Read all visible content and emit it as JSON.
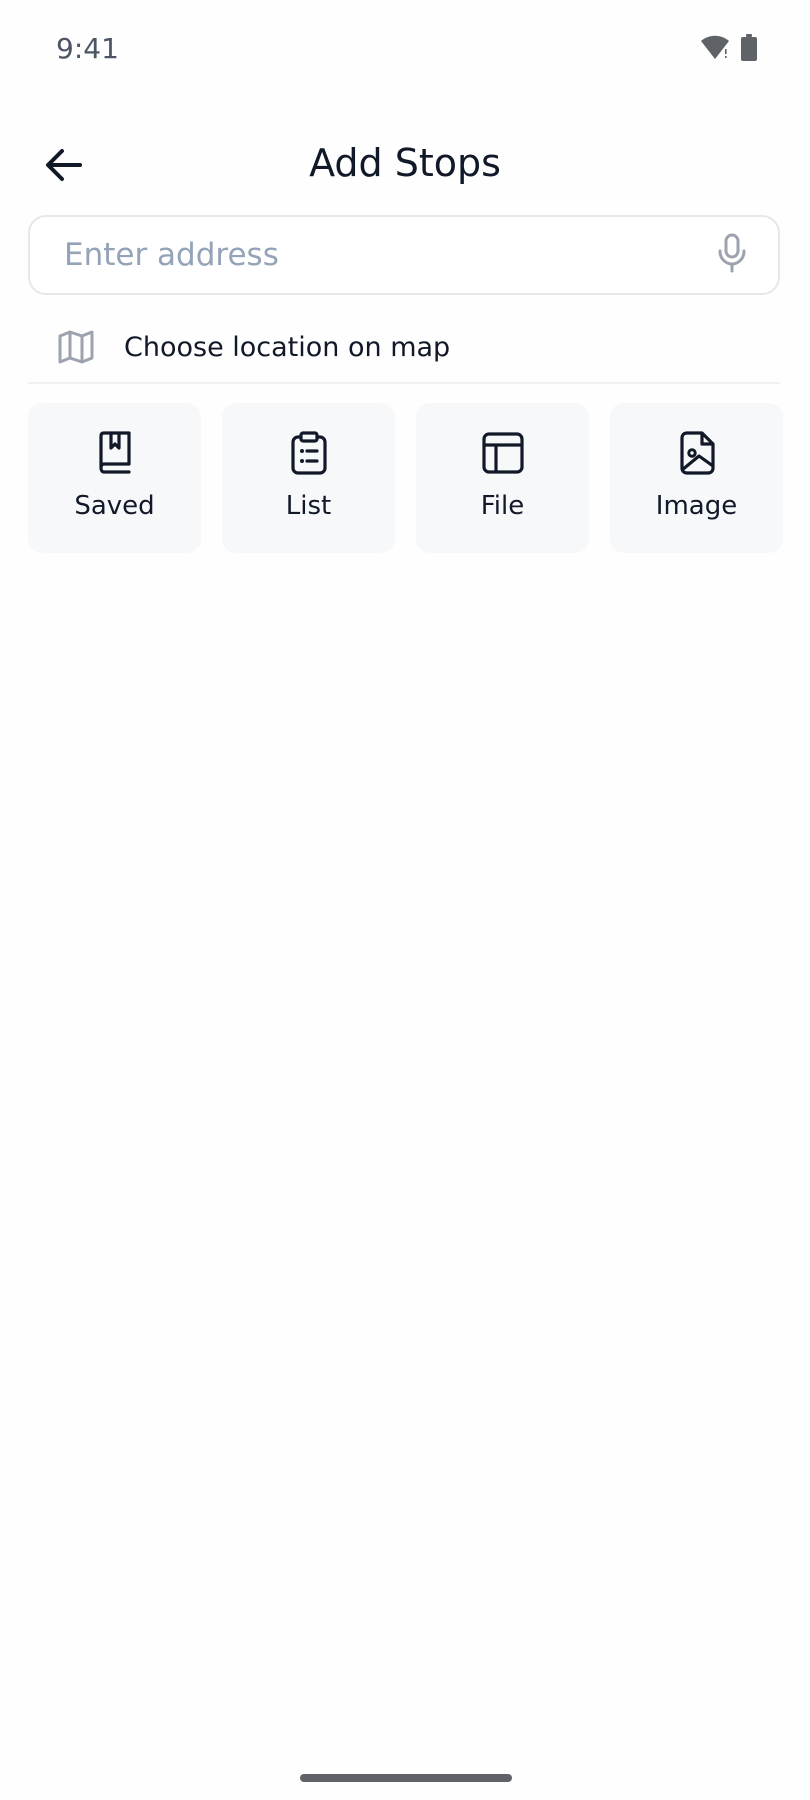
{
  "status_bar": {
    "time": "9:41"
  },
  "header": {
    "title": "Add Stops"
  },
  "search": {
    "placeholder": "Enter address",
    "value": ""
  },
  "map_option": {
    "label": "Choose location on map"
  },
  "sources": [
    {
      "label": "Saved",
      "icon": "bookmark-book-icon"
    },
    {
      "label": "List",
      "icon": "clipboard-list-icon"
    },
    {
      "label": "File",
      "icon": "table-file-icon"
    },
    {
      "label": "Image",
      "icon": "image-file-icon"
    }
  ],
  "colors": {
    "text": "#111827",
    "placeholder": "#94a3b8",
    "tile_bg": "#f7f8fa",
    "border": "#e5e7eb",
    "muted_icon": "#9ca3af"
  }
}
